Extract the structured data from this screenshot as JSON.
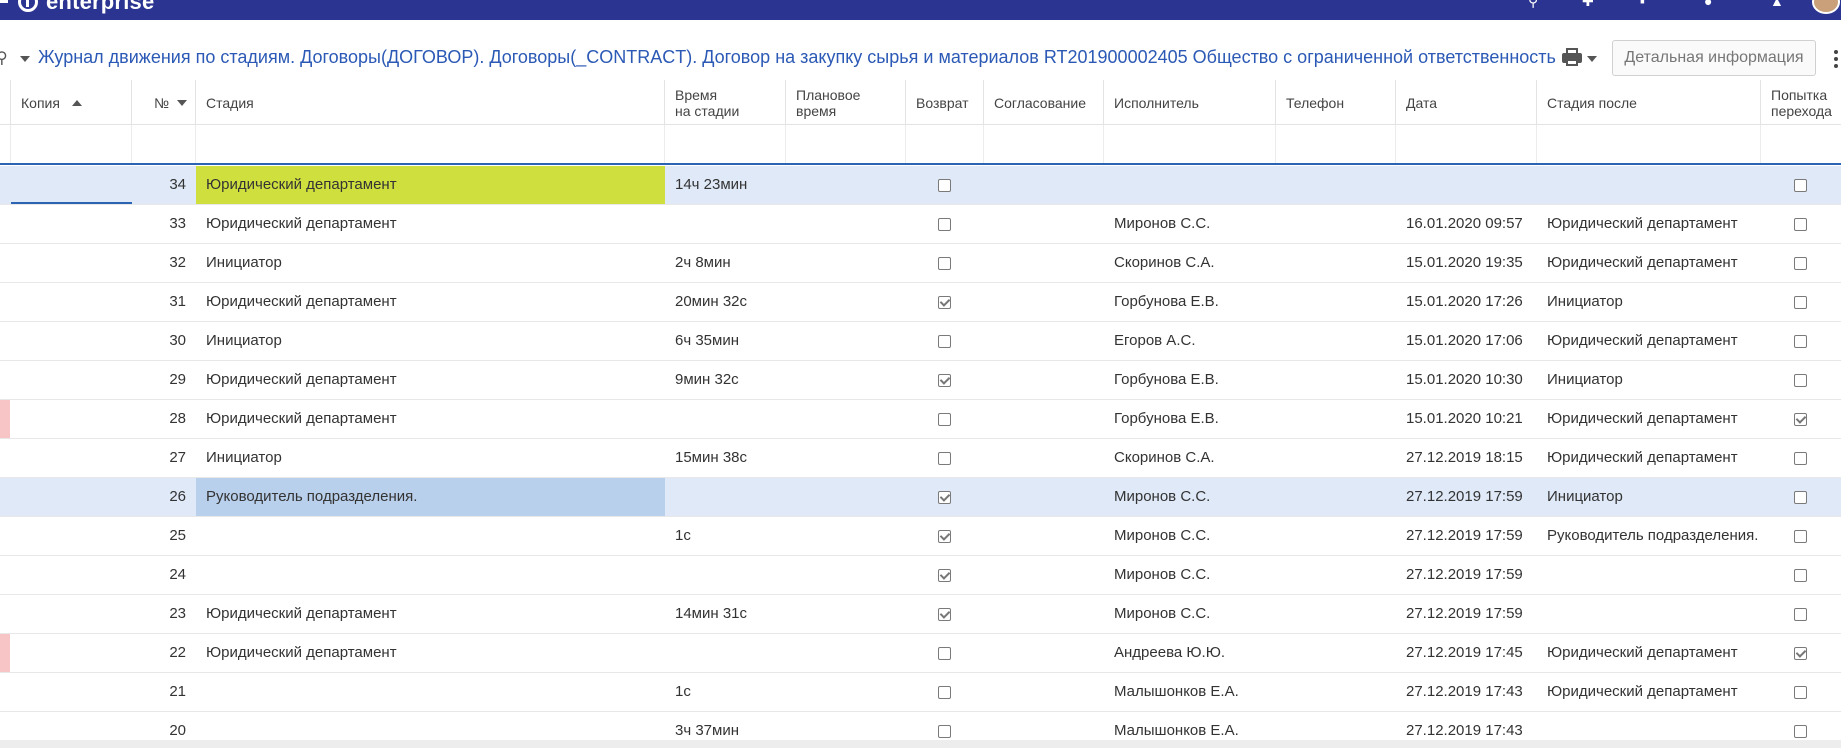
{
  "app": {
    "logo_text": "enterprise"
  },
  "titlebar": {
    "title": "Журнал движения по стадиям. Договоры(ДОГОВОР). Договоры(_CONTRACT). Договор на закупку сырья и материалов RT201900002405 Общество с ограниченной ответственностью",
    "detail_button": "Детальная информация"
  },
  "columns": {
    "copy": "Копия",
    "num": "№",
    "stage": "Стадия",
    "time_l1": "Время",
    "time_l2": "на стадии",
    "plan_l1": "Плановое",
    "plan_l2": "время",
    "ret": "Возврат",
    "approval": "Согласование",
    "executor": "Исполнитель",
    "phone": "Телефон",
    "date": "Дата",
    "stage_after": "Стадия после",
    "attempt_l1": "Попытка",
    "attempt_l2": "перехода"
  },
  "rows": [
    {
      "num": "34",
      "stage": "Юридический департамент",
      "time": "14ч 23мин",
      "ret": false,
      "executor": "",
      "date": "",
      "after": "",
      "attempt": false
    },
    {
      "num": "33",
      "stage": "Юридический департамент",
      "time": "",
      "ret": false,
      "executor": "Миронов С.С.",
      "date": "16.01.2020 09:57",
      "after": "Юридический департамент",
      "attempt": false
    },
    {
      "num": "32",
      "stage": "Инициатор",
      "time": "2ч 8мин",
      "ret": false,
      "executor": "Скоринов С.А.",
      "date": "15.01.2020 19:35",
      "after": "Юридический департамент",
      "attempt": false
    },
    {
      "num": "31",
      "stage": "Юридический департамент",
      "time": "20мин 32с",
      "ret": true,
      "executor": "Горбунова Е.В.",
      "date": "15.01.2020 17:26",
      "after": "Инициатор",
      "attempt": false
    },
    {
      "num": "30",
      "stage": "Инициатор",
      "time": "6ч 35мин",
      "ret": false,
      "executor": "Егоров А.С.",
      "date": "15.01.2020 17:06",
      "after": "Юридический департамент",
      "attempt": false
    },
    {
      "num": "29",
      "stage": "Юридический департамент",
      "time": "9мин 32с",
      "ret": true,
      "executor": "Горбунова Е.В.",
      "date": "15.01.2020 10:30",
      "after": "Инициатор",
      "attempt": false
    },
    {
      "num": "28",
      "stage": "Юридический департамент",
      "time": "",
      "ret": false,
      "executor": "Горбунова Е.В.",
      "date": "15.01.2020 10:21",
      "after": "Юридический департамент",
      "attempt": true
    },
    {
      "num": "27",
      "stage": "Инициатор",
      "time": "15мин 38с",
      "ret": false,
      "executor": "Скоринов С.А.",
      "date": "27.12.2019 18:15",
      "after": "Юридический департамент",
      "attempt": false
    },
    {
      "num": "26",
      "stage": "Руководитель подразделения.",
      "time": "",
      "ret": true,
      "executor": "Миронов С.С.",
      "date": "27.12.2019 17:59",
      "after": "Инициатор",
      "attempt": false
    },
    {
      "num": "25",
      "stage": "",
      "time": "1с",
      "ret": true,
      "executor": "Миронов С.С.",
      "date": "27.12.2019 17:59",
      "after": "Руководитель подразделения.",
      "attempt": false
    },
    {
      "num": "24",
      "stage": "",
      "time": "",
      "ret": true,
      "executor": "Миронов С.С.",
      "date": "27.12.2019 17:59",
      "after": "",
      "attempt": false
    },
    {
      "num": "23",
      "stage": "Юридический департамент",
      "time": "14мин 31с",
      "ret": true,
      "executor": "Миронов С.С.",
      "date": "27.12.2019 17:59",
      "after": "",
      "attempt": false
    },
    {
      "num": "22",
      "stage": "Юридический департамент",
      "time": "",
      "ret": false,
      "executor": "Андреева Ю.Ю.",
      "date": "27.12.2019 17:45",
      "after": "Юридический департамент",
      "attempt": true
    },
    {
      "num": "21",
      "stage": "",
      "time": "1с",
      "ret": false,
      "executor": "Малышонков Е.А.",
      "date": "27.12.2019 17:43",
      "after": "Юридический департамент",
      "attempt": false
    },
    {
      "num": "20",
      "stage": "",
      "time": "3ч 37мин",
      "ret": false,
      "executor": "Малышонков Е.А.",
      "date": "27.12.2019 17:43",
      "after": "",
      "attempt": false
    }
  ]
}
